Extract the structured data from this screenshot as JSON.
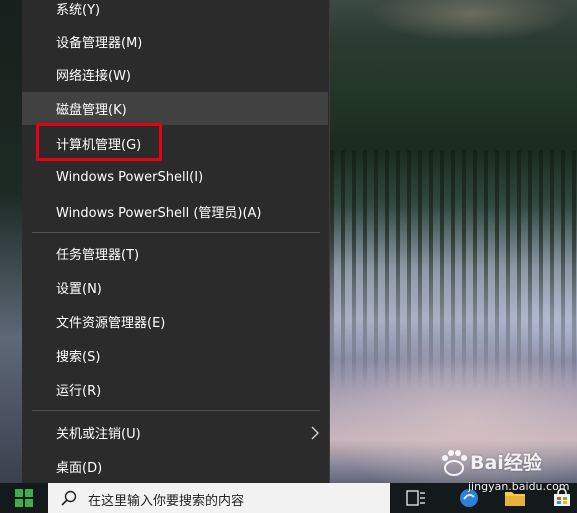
{
  "context_menu": {
    "items": [
      {
        "label": "系统(Y)"
      },
      {
        "label": "设备管理器(M)"
      },
      {
        "label": "网络连接(W)"
      },
      {
        "label": "磁盘管理(K)"
      },
      {
        "label": "计算机管理(G)"
      },
      {
        "label": "Windows PowerShell(I)"
      },
      {
        "label": "Windows PowerShell (管理员)(A)"
      },
      {
        "label": "任务管理器(T)"
      },
      {
        "label": "设置(N)"
      },
      {
        "label": "文件资源管理器(E)"
      },
      {
        "label": "搜索(S)"
      },
      {
        "label": "运行(R)"
      },
      {
        "label": "关机或注销(U)"
      },
      {
        "label": "桌面(D)"
      }
    ],
    "hovered_item": "磁盘管理(K)",
    "highlighted_item": "计算机管理(G)",
    "highlight_color": "#e60012"
  },
  "taskbar": {
    "search_placeholder": "在这里输入你要搜索的内容",
    "icons": [
      "windows-start-icon",
      "search-icon",
      "task-view-icon",
      "file-explorer-icon",
      "store-icon"
    ]
  },
  "watermark": {
    "brand": "Bai经验",
    "url": "jingyan.baidu.com"
  }
}
